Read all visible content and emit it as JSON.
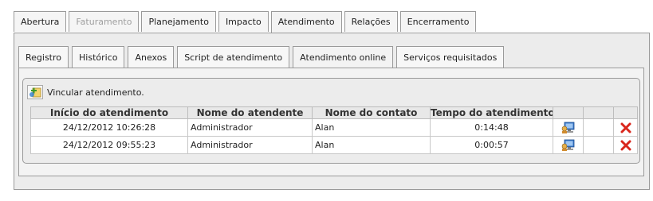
{
  "main_tabs": [
    {
      "label": "Abertura",
      "state": "normal"
    },
    {
      "label": "Faturamento",
      "state": "disabled"
    },
    {
      "label": "Planejamento",
      "state": "normal"
    },
    {
      "label": "Impacto",
      "state": "normal"
    },
    {
      "label": "Atendimento",
      "state": "active"
    },
    {
      "label": "Relações",
      "state": "normal"
    },
    {
      "label": "Encerramento",
      "state": "normal"
    }
  ],
  "sub_tabs": [
    {
      "label": "Registro",
      "state": "normal"
    },
    {
      "label": "Histórico",
      "state": "normal"
    },
    {
      "label": "Anexos",
      "state": "normal"
    },
    {
      "label": "Script de atendimento",
      "state": "normal"
    },
    {
      "label": "Atendimento online",
      "state": "active"
    },
    {
      "label": "Serviços requisitados",
      "state": "normal"
    }
  ],
  "link_action": {
    "label": "Vincular atendimento.",
    "icon": "add-link-icon"
  },
  "table": {
    "headers": {
      "inicio": "Início do atendimento",
      "atendente": "Nome do atendente",
      "contato": "Nome do contato",
      "tempo": "Tempo do atendimento"
    },
    "rows": [
      {
        "inicio": "24/12/2012 10:26:28",
        "atendente": "Administrador",
        "contato": "Alan",
        "tempo": "0:14:48"
      },
      {
        "inicio": "24/12/2012 09:55:23",
        "atendente": "Administrador",
        "contato": "Alan",
        "tempo": "0:00:57"
      }
    ],
    "row_icons": {
      "view": "chat-monitor-icon",
      "delete": "delete-x-icon"
    }
  },
  "colors": {
    "border": "#9a9a9a",
    "panel": "#ececec",
    "delete": "#d9261c",
    "add": "#3a9a2a"
  }
}
